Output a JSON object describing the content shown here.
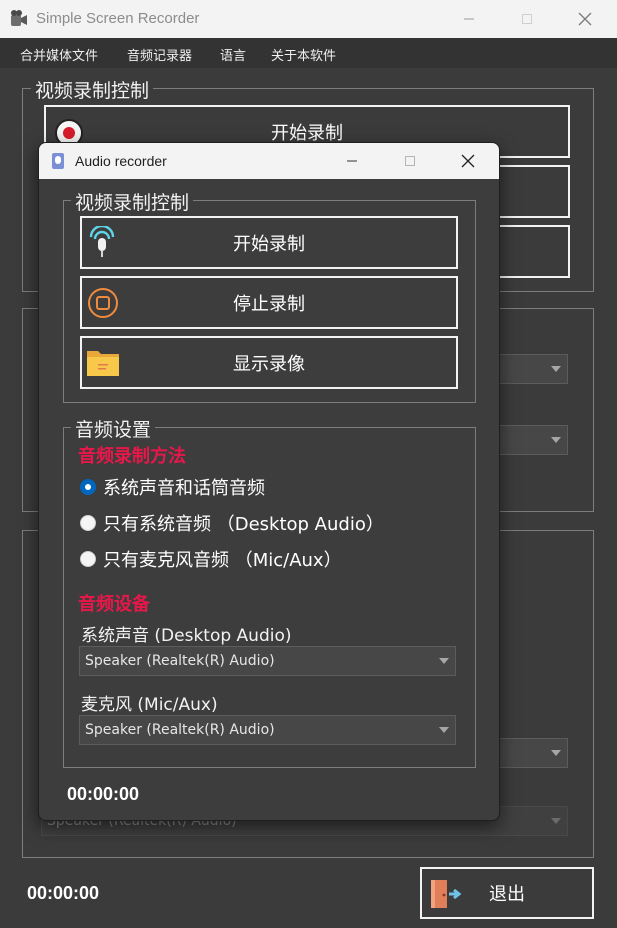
{
  "main_window": {
    "title": "Simple Screen Recorder",
    "menu": [
      "合并媒体文件",
      "音频记录器",
      "语言",
      "关于本软件"
    ],
    "video_group_title": "视频录制控制",
    "start_button_label": "开始录制",
    "bottom_combo_value": "Speaker (Realtek(R) Audio)",
    "timer": "00:00:00",
    "exit_button_label": "退出"
  },
  "dialog": {
    "title": "Audio recorder",
    "video_group_title": "视频录制控制",
    "buttons": {
      "start": "开始录制",
      "stop": "停止录制",
      "show": "显示录像"
    },
    "audio_settings": {
      "title": "音频设置",
      "method_title": "音频录制方法",
      "options": [
        {
          "label": "系统声音和话筒音频",
          "checked": true
        },
        {
          "label": "只有系统音频 （Desktop Audio）",
          "checked": false
        },
        {
          "label": "只有麦克风音频 （Mic/Aux）",
          "checked": false
        }
      ],
      "devices_title": "音频设备",
      "system_sound_label": "系统声音 (Desktop Audio)",
      "system_sound_value": "Speaker (Realtek(R) Audio)",
      "mic_label": "麦克风 (Mic/Aux)",
      "mic_value": "Speaker (Realtek(R) Audio)"
    },
    "timer": "00:00:00"
  },
  "colors": {
    "background": "#3b3b3b",
    "accent_red": "#e8174a",
    "radio_blue": "#0067c0"
  }
}
